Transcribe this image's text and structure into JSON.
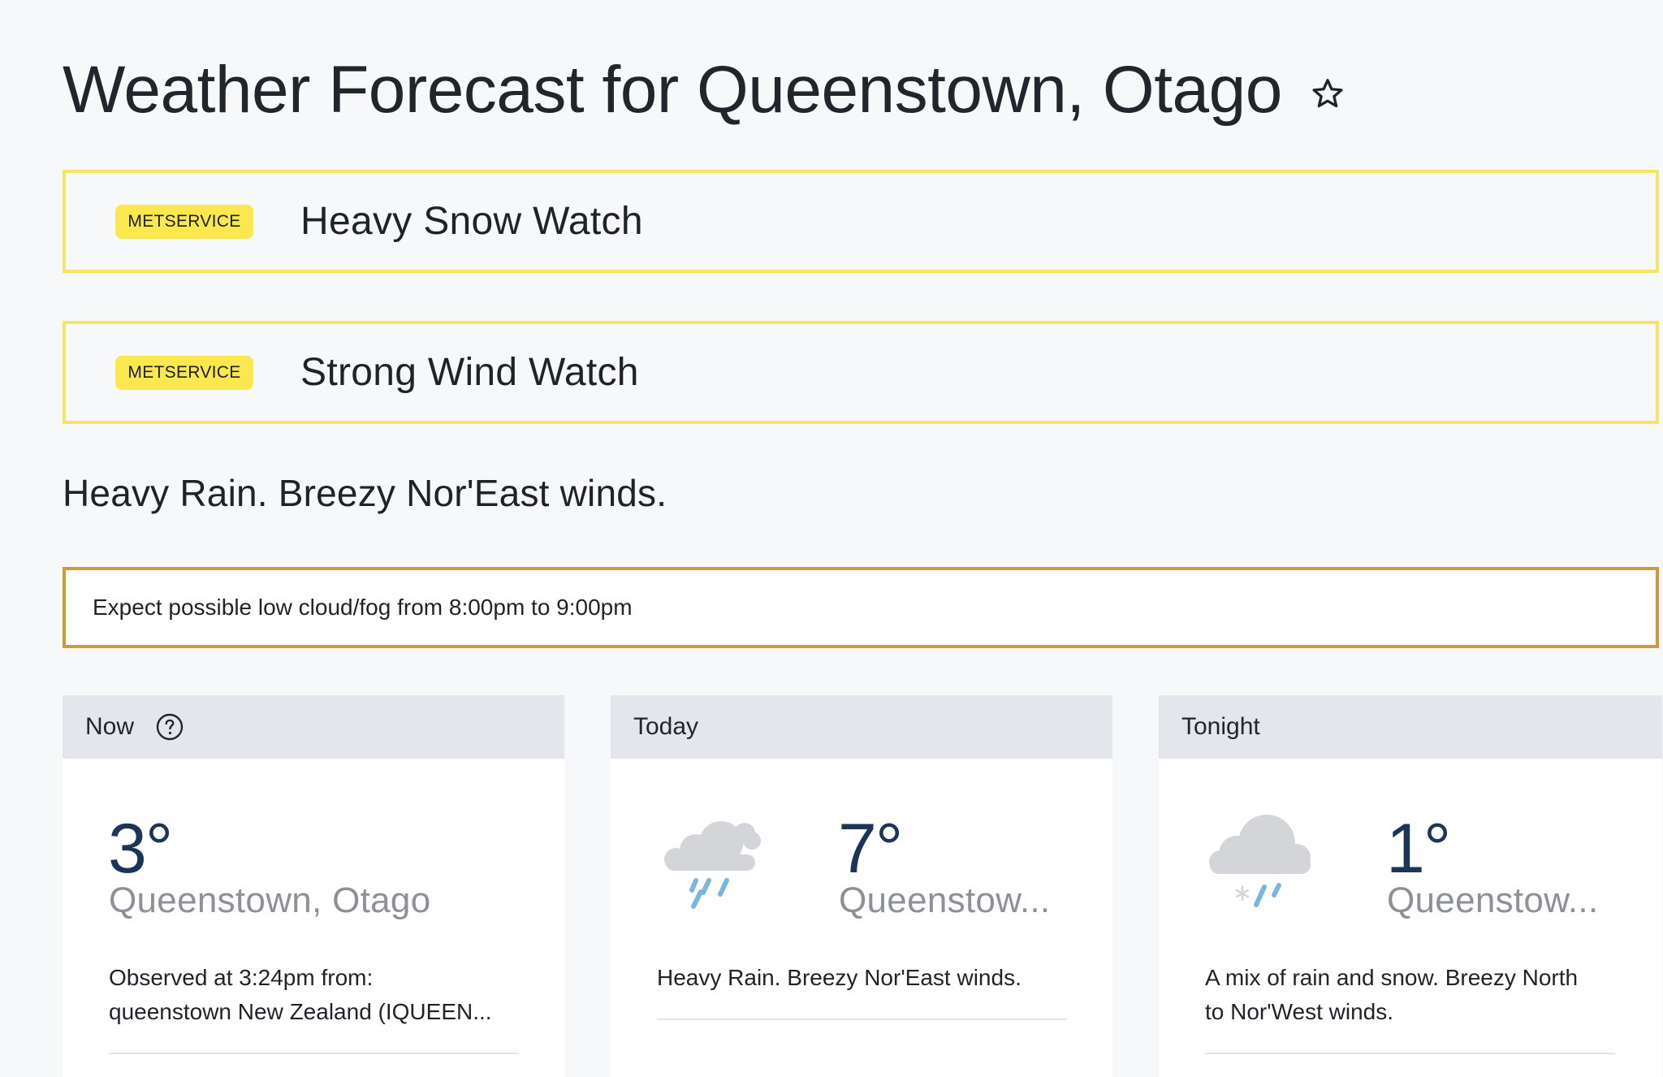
{
  "header": {
    "title": "Weather Forecast for Queenstown, Otago",
    "favourite_icon": "star-outline-icon"
  },
  "warnings": [
    {
      "badge": "METSERVICE",
      "label": "Heavy Snow Watch"
    },
    {
      "badge": "METSERVICE",
      "label": "Strong Wind Watch"
    }
  ],
  "colors": {
    "warning_border": "#f4e563",
    "badge_bg": "#fbe84f",
    "notice_border": "#d09a35",
    "temperature": "#1c3557",
    "rain_drop": "#7ab6e0",
    "cloud": "#d3d5d8"
  },
  "summary": "Heavy Rain. Breezy Nor'East winds.",
  "notice": "Expect possible low cloud/fog from 8:00pm to 9:00pm",
  "cards": {
    "now": {
      "header": "Now",
      "help_icon": "question-circle-icon",
      "temperature": "3°",
      "location": "Queenstown, Otago",
      "observed_line1": "Observed at 3:24pm from:",
      "observed_line2": "queenstown New Zealand (IQUEEN..."
    },
    "today": {
      "header": "Today",
      "icon": "heavy-rain-icon",
      "temperature": "7°",
      "location": "Queenstow...",
      "description": "Heavy Rain. Breezy Nor'East winds."
    },
    "tonight": {
      "header": "Tonight",
      "icon": "rain-and-snow-icon",
      "temperature": "1°",
      "location": "Queenstow...",
      "description_line1": "A mix of rain and snow. Breezy North",
      "description_line2": "to Nor'West winds."
    }
  }
}
